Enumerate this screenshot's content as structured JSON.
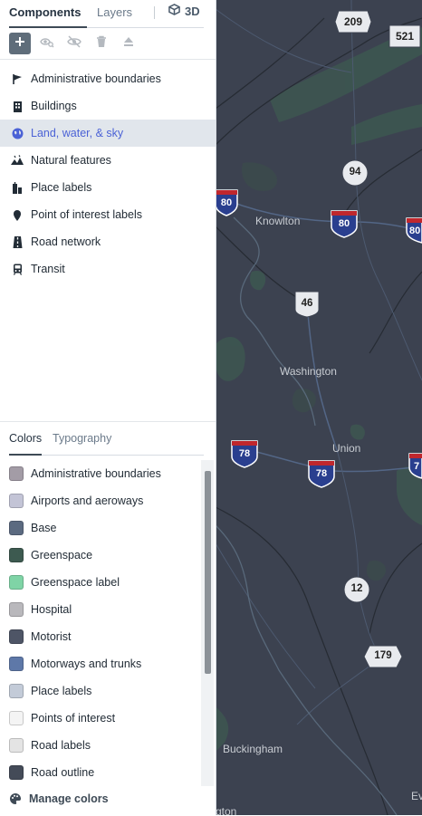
{
  "tabs": {
    "components": "Components",
    "layers": "Layers",
    "three_d": "3D"
  },
  "components": [
    {
      "label": "Administrative boundaries",
      "icon": "flag-icon"
    },
    {
      "label": "Buildings",
      "icon": "building-icon"
    },
    {
      "label": "Land, water, & sky",
      "icon": "globe-icon",
      "selected": true
    },
    {
      "label": "Natural features",
      "icon": "mountain-icon"
    },
    {
      "label": "Place labels",
      "icon": "place-label-icon"
    },
    {
      "label": "Point of interest labels",
      "icon": "map-pin-icon"
    },
    {
      "label": "Road network",
      "icon": "road-icon"
    },
    {
      "label": "Transit",
      "icon": "train-icon"
    }
  ],
  "bottom_tabs": {
    "colors": "Colors",
    "typography": "Typography"
  },
  "colors": [
    {
      "label": "Administrative boundaries",
      "color": "#a39ca6"
    },
    {
      "label": "Airports and aeroways",
      "color": "#c3c4d6"
    },
    {
      "label": "Base",
      "color": "#5b6a80"
    },
    {
      "label": "Greenspace",
      "color": "#3d5a50"
    },
    {
      "label": "Greenspace label",
      "color": "#7fd4a6"
    },
    {
      "label": "Hospital",
      "color": "#b9b8bc"
    },
    {
      "label": "Motorist",
      "color": "#4e5566"
    },
    {
      "label": "Motorways and trunks",
      "color": "#5e78a8"
    },
    {
      "label": "Place labels",
      "color": "#c3cbd8"
    },
    {
      "label": "Points of interest",
      "color": "#f4f4f4"
    },
    {
      "label": "Road labels",
      "color": "#e4e4e4"
    },
    {
      "label": "Road outline",
      "color": "#444b58"
    }
  ],
  "manage_colors": "Manage colors",
  "map": {
    "shields": [
      "209",
      "521",
      "94",
      "80",
      "80",
      "80",
      "46",
      "78",
      "78",
      "7",
      "12",
      "179"
    ],
    "places": [
      "Knowlton",
      "Washington",
      "Union",
      "Buckingham",
      "Ev",
      "gton"
    ]
  }
}
